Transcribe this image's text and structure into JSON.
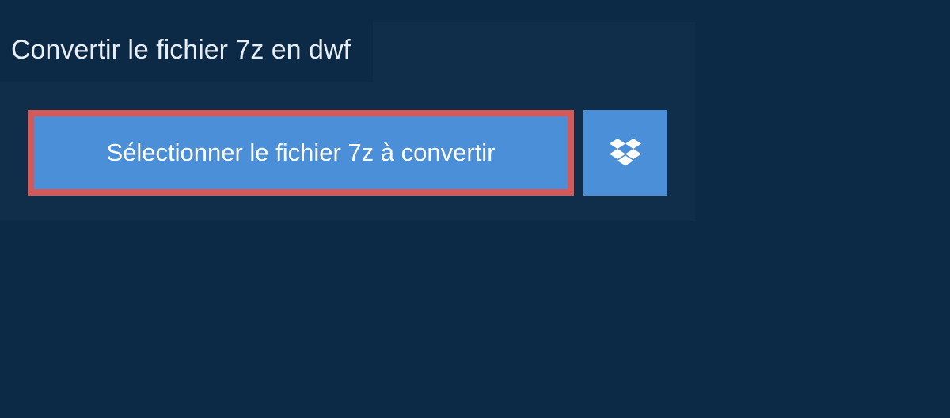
{
  "title": "Convertir le fichier 7z en dwf",
  "selectButton": {
    "label": "Sélectionner le fichier 7z à convertir"
  }
}
